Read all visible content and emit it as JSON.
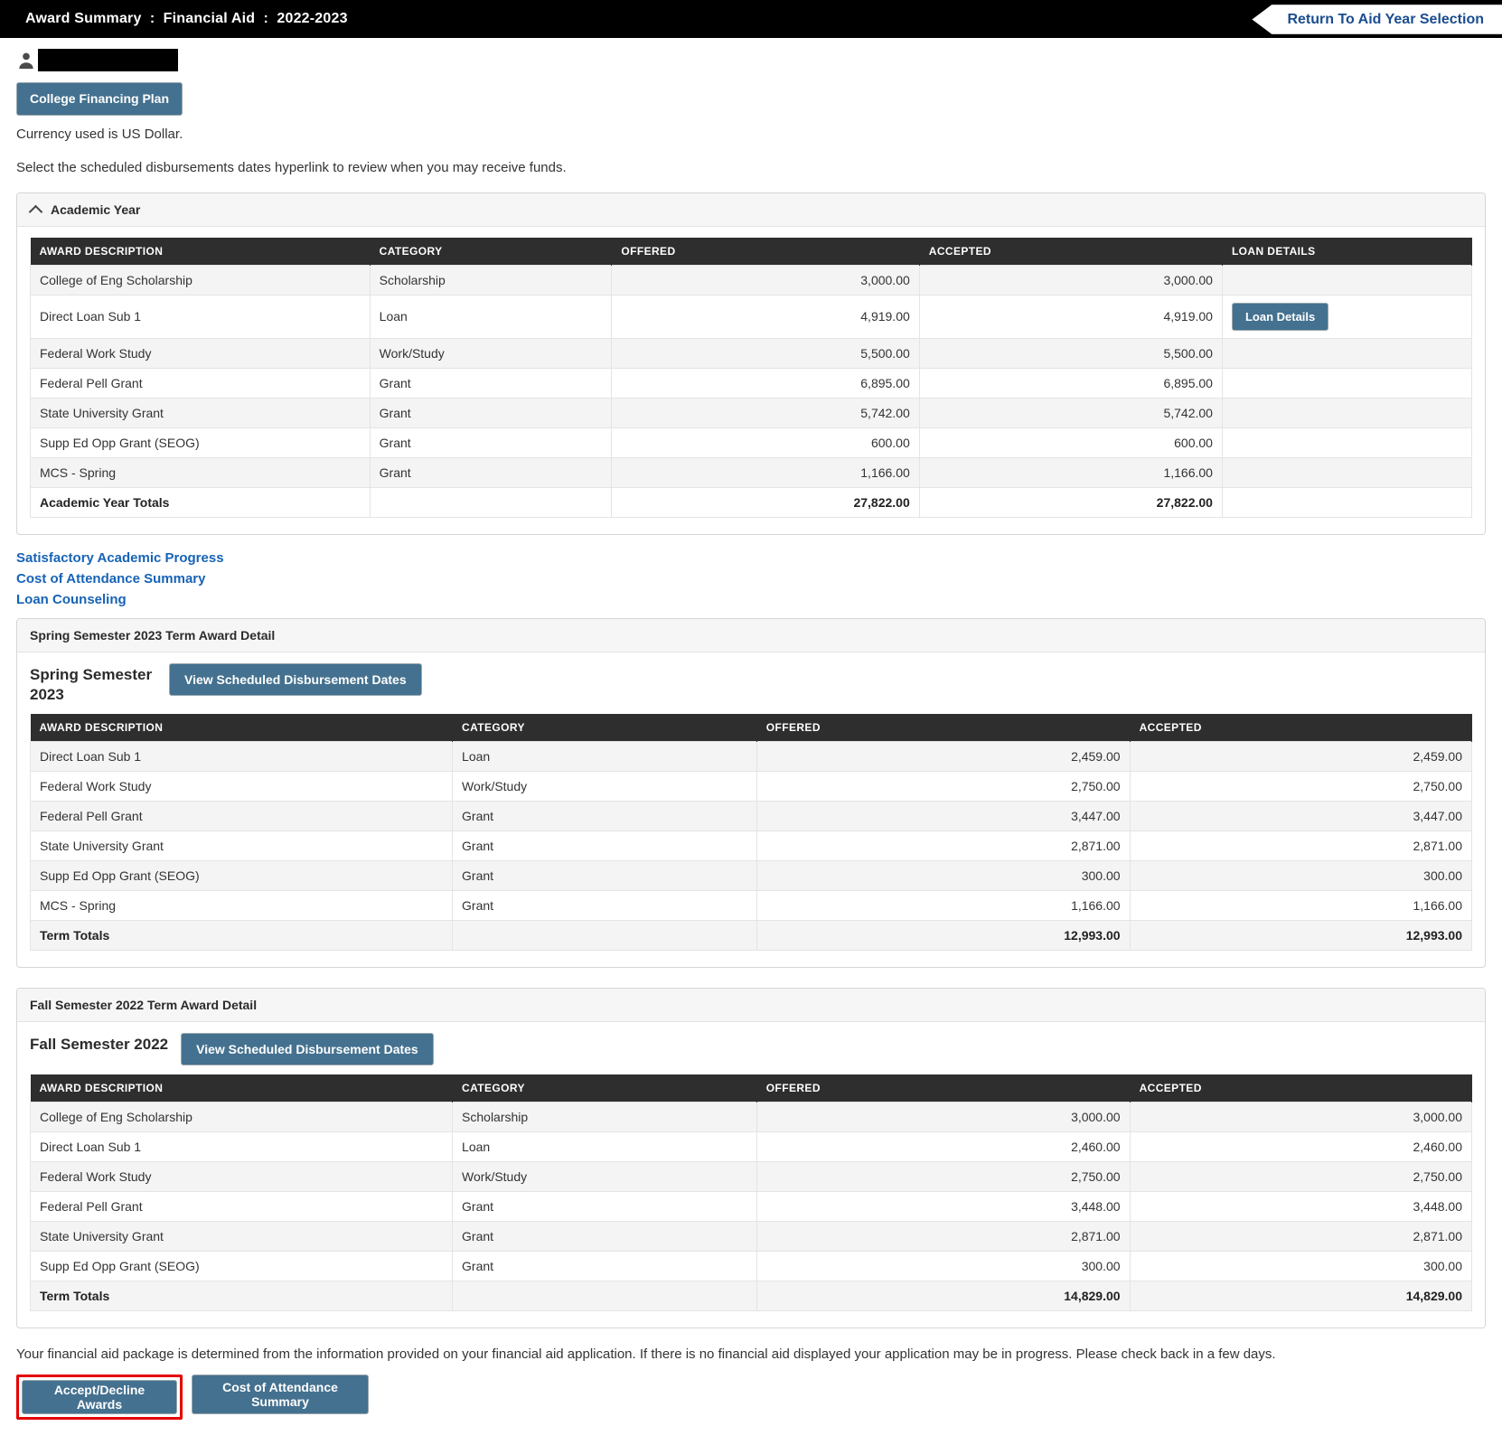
{
  "header": {
    "title": "Award Summary  :  Financial Aid  :  2022-2023",
    "return_link": "Return To Aid Year Selection"
  },
  "identity": {
    "icon": "person-icon",
    "name_redacted": ""
  },
  "actions": {
    "college_financing_plan": "College Financing Plan",
    "loan_details": "Loan Details",
    "view_disbursement_dates": "View Scheduled Disbursement Dates",
    "accept_decline_awards": "Accept/Decline Awards",
    "cost_of_attendance_summary": "Cost of Attendance Summary"
  },
  "notes": {
    "currency": "Currency used is US Dollar.",
    "disbursement_hint": "Select the scheduled disbursements dates hyperlink to review when you may receive funds.",
    "footer": "Your financial aid package is determined from the information provided on your financial aid application. If there is no financial aid displayed your application may be in progress. Please check back in a few days."
  },
  "academic_year": {
    "panel_title": "Academic Year",
    "columns": [
      "AWARD DESCRIPTION",
      "CATEGORY",
      "OFFERED",
      "ACCEPTED",
      "LOAN DETAILS"
    ],
    "rows": [
      {
        "description": "College of Eng Scholarship",
        "category": "Scholarship",
        "offered": "3,000.00",
        "accepted": "3,000.00",
        "loan_details": false
      },
      {
        "description": "Direct Loan Sub 1",
        "category": "Loan",
        "offered": "4,919.00",
        "accepted": "4,919.00",
        "loan_details": true
      },
      {
        "description": "Federal Work Study",
        "category": "Work/Study",
        "offered": "5,500.00",
        "accepted": "5,500.00",
        "loan_details": false
      },
      {
        "description": "Federal Pell Grant",
        "category": "Grant",
        "offered": "6,895.00",
        "accepted": "6,895.00",
        "loan_details": false
      },
      {
        "description": "State University Grant",
        "category": "Grant",
        "offered": "5,742.00",
        "accepted": "5,742.00",
        "loan_details": false
      },
      {
        "description": "Supp Ed Opp Grant (SEOG)",
        "category": "Grant",
        "offered": "600.00",
        "accepted": "600.00",
        "loan_details": false
      },
      {
        "description": "MCS - Spring",
        "category": "Grant",
        "offered": "1,166.00",
        "accepted": "1,166.00",
        "loan_details": false
      }
    ],
    "totals": {
      "label": "Academic Year Totals",
      "offered": "27,822.00",
      "accepted": "27,822.00"
    }
  },
  "links": [
    {
      "label": "Satisfactory Academic Progress"
    },
    {
      "label": "Cost of Attendance Summary"
    },
    {
      "label": "Loan Counseling"
    }
  ],
  "spring_term": {
    "panel_title": "Spring Semester 2023 Term Award Detail",
    "term_title": "Spring Semester 2023",
    "columns": [
      "AWARD DESCRIPTION",
      "CATEGORY",
      "OFFERED",
      "ACCEPTED"
    ],
    "rows": [
      {
        "description": "Direct Loan Sub 1",
        "category": "Loan",
        "offered": "2,459.00",
        "accepted": "2,459.00"
      },
      {
        "description": "Federal Work Study",
        "category": "Work/Study",
        "offered": "2,750.00",
        "accepted": "2,750.00"
      },
      {
        "description": "Federal Pell Grant",
        "category": "Grant",
        "offered": "3,447.00",
        "accepted": "3,447.00"
      },
      {
        "description": "State University Grant",
        "category": "Grant",
        "offered": "2,871.00",
        "accepted": "2,871.00"
      },
      {
        "description": "Supp Ed Opp Grant (SEOG)",
        "category": "Grant",
        "offered": "300.00",
        "accepted": "300.00"
      },
      {
        "description": "MCS - Spring",
        "category": "Grant",
        "offered": "1,166.00",
        "accepted": "1,166.00"
      }
    ],
    "totals": {
      "label": "Term Totals",
      "offered": "12,993.00",
      "accepted": "12,993.00"
    }
  },
  "fall_term": {
    "panel_title": "Fall Semester 2022 Term Award Detail",
    "term_title": "Fall Semester 2022",
    "columns": [
      "AWARD DESCRIPTION",
      "CATEGORY",
      "OFFERED",
      "ACCEPTED"
    ],
    "rows": [
      {
        "description": "College of Eng Scholarship",
        "category": "Scholarship",
        "offered": "3,000.00",
        "accepted": "3,000.00"
      },
      {
        "description": "Direct Loan Sub 1",
        "category": "Loan",
        "offered": "2,460.00",
        "accepted": "2,460.00"
      },
      {
        "description": "Federal Work Study",
        "category": "Work/Study",
        "offered": "2,750.00",
        "accepted": "2,750.00"
      },
      {
        "description": "Federal Pell Grant",
        "category": "Grant",
        "offered": "3,448.00",
        "accepted": "3,448.00"
      },
      {
        "description": "State University Grant",
        "category": "Grant",
        "offered": "2,871.00",
        "accepted": "2,871.00"
      },
      {
        "description": "Supp Ed Opp Grant (SEOG)",
        "category": "Grant",
        "offered": "300.00",
        "accepted": "300.00"
      }
    ],
    "totals": {
      "label": "Term Totals",
      "offered": "14,829.00",
      "accepted": "14,829.00"
    }
  },
  "colors": {
    "header_bar": "#000000",
    "button_blue": "#44718f",
    "link_blue": "#1763b6",
    "table_header": "#2e2e2e",
    "highlight_red": "#e60000"
  }
}
